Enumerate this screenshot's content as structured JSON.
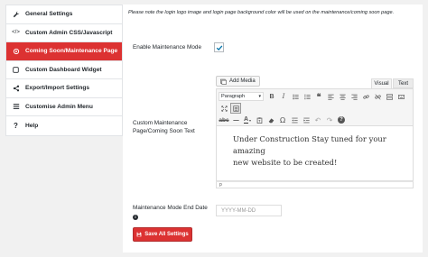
{
  "sidebar": {
    "items": [
      {
        "label": "General Settings",
        "icon": "wrench-icon"
      },
      {
        "label": "Custom Admin CSS/Javascript",
        "icon": "code-icon"
      },
      {
        "label": "Coming Soon/Maintenance Page",
        "icon": "gear-icon",
        "active": true
      },
      {
        "label": "Custom Dashboard Widget",
        "icon": "square-icon"
      },
      {
        "label": "Export/Import Settings",
        "icon": "share-icon"
      },
      {
        "label": "Customise Admin Menu",
        "icon": "menu-icon"
      },
      {
        "label": "Help",
        "icon": "help-icon"
      }
    ]
  },
  "main": {
    "notice": "Please note the login logo image and login page background color will be used on the maintenance/coming soon page.",
    "enable_label": "Enable Maintenance Mode",
    "enable_checked": true,
    "text_label_line1": "Custom Maintenance",
    "text_label_line2": "Page/Coming Soon Text",
    "editor": {
      "add_media": "Add Media",
      "tab_visual": "Visual",
      "tab_text": "Text",
      "format": "Paragraph",
      "content_line1": "Under Construction Stay tuned for your amazing",
      "content_line2": "new website to be created!",
      "path": "p"
    },
    "date_label": "Maintenance Mode End Date",
    "date_info": "i",
    "date_placeholder": "YYYY-MM-DD",
    "save_label": "Save All Settings"
  },
  "colors": {
    "accent": "#dc3232",
    "check": "#0073aa"
  }
}
